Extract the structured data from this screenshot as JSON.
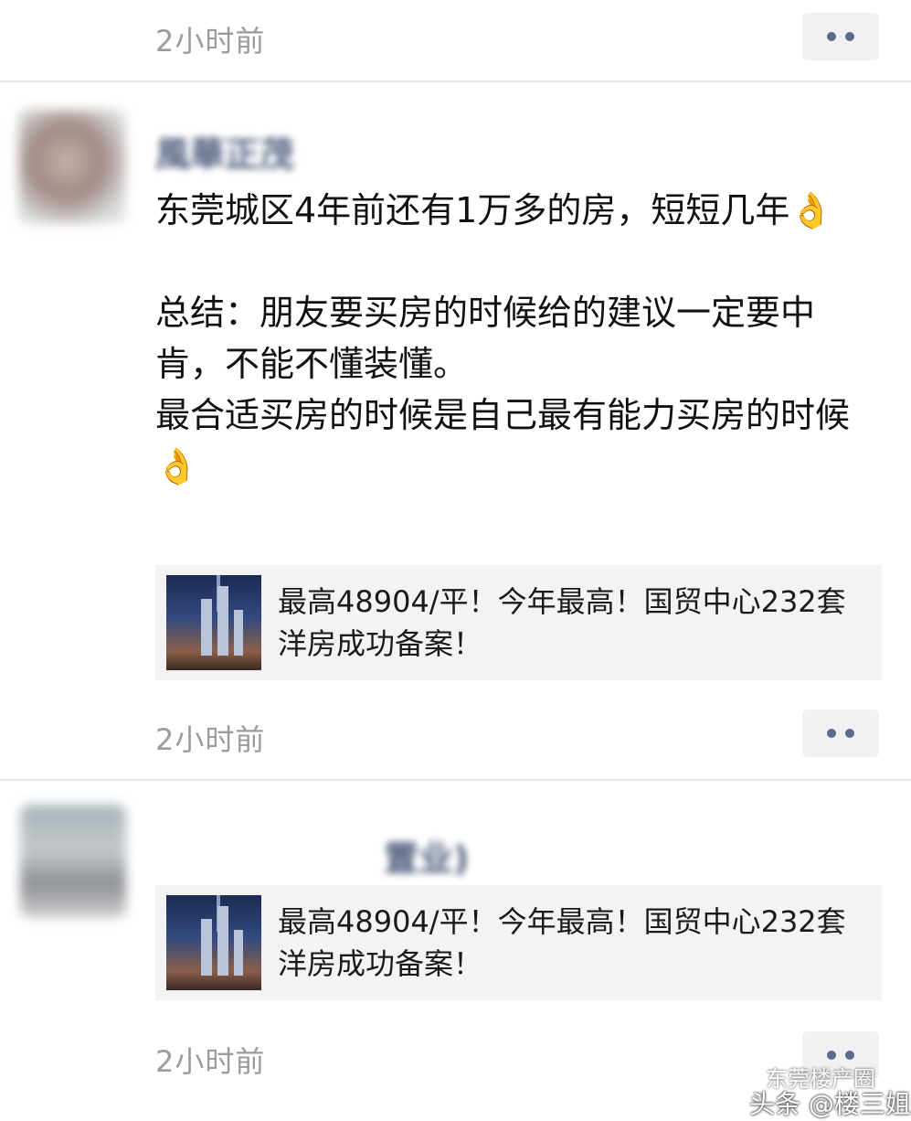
{
  "feed": {
    "top_item": {
      "time": "2小时前"
    },
    "comments": [
      {
        "author": "風華正茂",
        "paragraphs": [
          "东莞城区4年前还有1万多的房，短短几年👌",
          "",
          "总结：朋友要买房的时候给的建议一定要中肯，不能不懂装懂。",
          "最合适买房的时候是自己最有能力买房的时候👌"
        ],
        "link_title": "最高48904/平！今年最高！国贸中心232套洋房成功备案！",
        "time": "2小时前"
      },
      {
        "author": "置业)",
        "link_title": "最高48904/平！今年最高！国贸中心232套洋房成功备案！",
        "time": "2小时前"
      }
    ]
  },
  "watermark": {
    "text": "头条 @楼三姐",
    "faint": "东莞楼产圈"
  }
}
